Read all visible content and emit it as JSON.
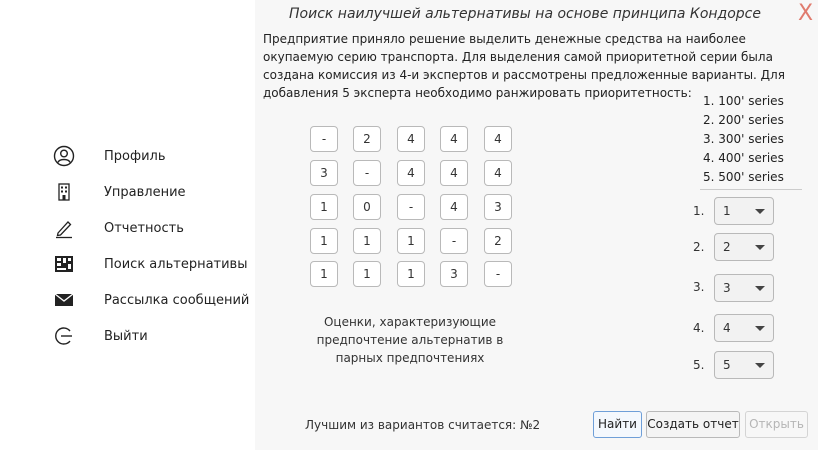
{
  "sidebar": {
    "items": [
      {
        "label": "Профиль",
        "icon": "user-icon"
      },
      {
        "label": "Управление",
        "icon": "building-icon"
      },
      {
        "label": "Отчетность",
        "icon": "pencil-icon"
      },
      {
        "label": "Поиск альтернативы",
        "icon": "grid-icon"
      },
      {
        "label": "Рассылка сообщений",
        "icon": "envelope-icon"
      },
      {
        "label": "Выйти",
        "icon": "logout-icon"
      }
    ]
  },
  "main": {
    "title": "Поиск наилучшей альтернативы на основе принципа Кондорсе",
    "close_label": "X",
    "description": "Предприятие приняло решение выделить денежные средства на наиболее окупаемую серию транспорта. Для выделения самой приоритетной серии была создана комиссия из 4-и экспертов и рассмотрены предложенные варианты. Для добавления 5 эксперта необходимо ранжировать приоритетность:",
    "matrix": [
      [
        "-",
        "2",
        "4",
        "4",
        "4"
      ],
      [
        "3",
        "-",
        "4",
        "4",
        "4"
      ],
      [
        "1",
        "0",
        "-",
        "4",
        "3"
      ],
      [
        "1",
        "1",
        "1",
        "-",
        "2"
      ],
      [
        "1",
        "1",
        "1",
        "3",
        "-"
      ]
    ],
    "matrix_caption": "Оценки, характеризующие предпочтение альтернатив в парных предпочтениях",
    "series": [
      "1. 100' series",
      "2. 200' series",
      "3. 300' series",
      "4. 400' series",
      "5. 500' series"
    ],
    "ranking": [
      {
        "label": "1.",
        "value": "1"
      },
      {
        "label": "2.",
        "value": "2"
      },
      {
        "label": "3.",
        "value": "3"
      },
      {
        "label": "4.",
        "value": "4"
      },
      {
        "label": "5.",
        "value": "5"
      }
    ],
    "result_text": "Лучшим из вариантов считается: №2",
    "buttons": {
      "find": "Найти",
      "report": "Создать отчет",
      "open": "Открыть"
    }
  },
  "colors": {
    "close": "#e07b6e",
    "primary_border": "#6f9fd8",
    "panel_bg": "#f7f7f7"
  }
}
